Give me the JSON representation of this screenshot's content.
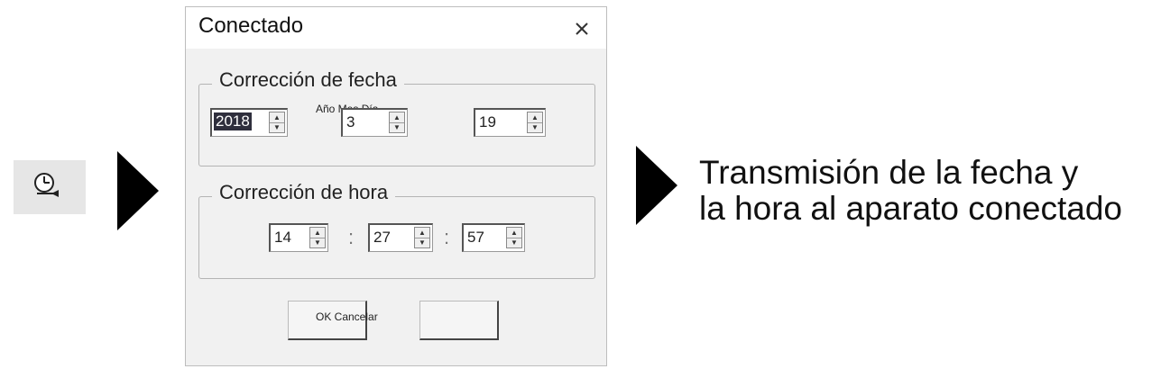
{
  "tool_icon": {
    "icon": "clock-sync-icon"
  },
  "arrows": {
    "icon": "arrow-right-icon"
  },
  "dialog": {
    "title": "Conectado",
    "close_icon": "close-icon",
    "date_group": {
      "label": "Corrección de fecha",
      "year_value": "2018",
      "month_value": "3",
      "day_value": "19",
      "field_labels": "Año Mes Día"
    },
    "time_group": {
      "label": "Corrección de hora",
      "hour_value": "14",
      "minute_value": "27",
      "second_value": "57",
      "separator": ":"
    },
    "buttons": {
      "labels": "OK Cancelar"
    }
  },
  "caption": {
    "line1": "Transmisión de la fecha y",
    "line2": "la hora al aparato conectado"
  },
  "colors": {
    "selected_bg": "#2f2f3d",
    "dialog_bg": "#f1f1f1"
  }
}
